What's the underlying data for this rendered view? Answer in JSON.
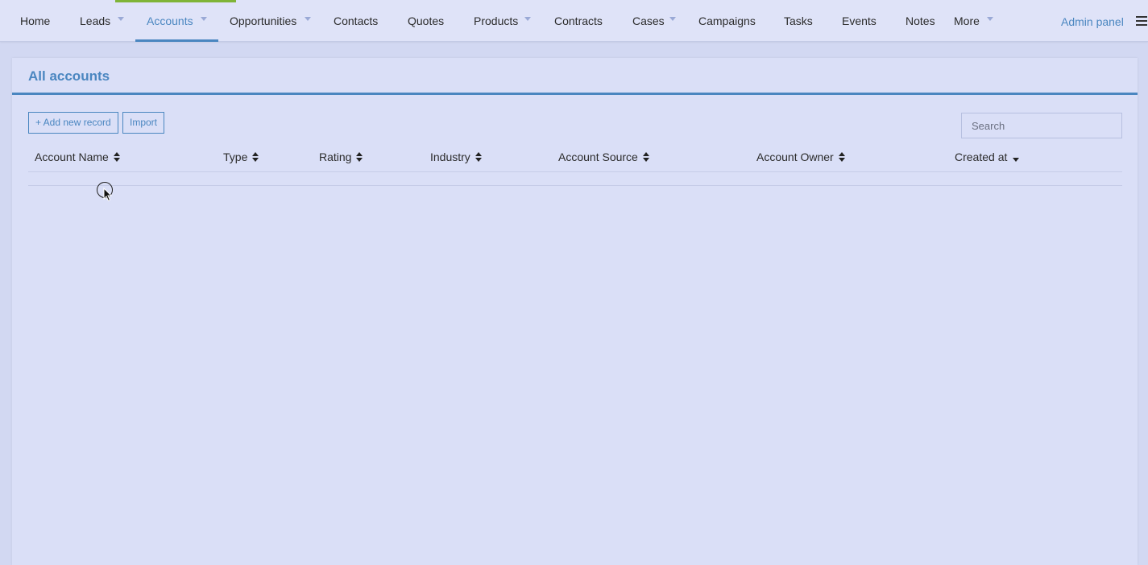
{
  "nav": {
    "items": [
      {
        "label": "Home",
        "has_dropdown": false
      },
      {
        "label": "Leads",
        "has_dropdown": true
      },
      {
        "label": "Accounts",
        "has_dropdown": true,
        "active": true
      },
      {
        "label": "Opportunities",
        "has_dropdown": true
      },
      {
        "label": "Contacts",
        "has_dropdown": false
      },
      {
        "label": "Quotes",
        "has_dropdown": false
      },
      {
        "label": "Products",
        "has_dropdown": true
      },
      {
        "label": "Contracts",
        "has_dropdown": false
      },
      {
        "label": "Cases",
        "has_dropdown": true
      },
      {
        "label": "Campaigns",
        "has_dropdown": false
      },
      {
        "label": "Tasks",
        "has_dropdown": false
      },
      {
        "label": "Events",
        "has_dropdown": false
      },
      {
        "label": "Notes",
        "has_dropdown": false
      },
      {
        "label": "More",
        "has_dropdown": true
      }
    ],
    "admin_label": "Admin panel",
    "menu_icon": "hamburger-icon"
  },
  "panel": {
    "title": "All accounts",
    "add_button_label": "+ Add new record",
    "import_button_label": "Import",
    "search_placeholder": "Search"
  },
  "table": {
    "columns": [
      {
        "label": "Account Name",
        "sort": "both"
      },
      {
        "label": "Type",
        "sort": "both"
      },
      {
        "label": "Rating",
        "sort": "both"
      },
      {
        "label": "Industry",
        "sort": "both"
      },
      {
        "label": "Account Source",
        "sort": "both"
      },
      {
        "label": "Account Owner",
        "sort": "both"
      },
      {
        "label": "Created at",
        "sort": "desc"
      }
    ],
    "rows": []
  },
  "colors": {
    "accent": "#4a86c0",
    "top_accent": "#7fb437",
    "background": "#d2d8f2",
    "panel": "#dadff7"
  }
}
